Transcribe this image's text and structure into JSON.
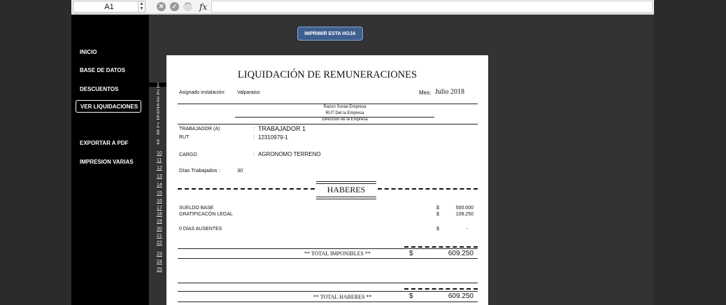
{
  "formula_bar": {
    "cell_ref": "A1",
    "fx_label": "fx"
  },
  "print_button": {
    "label": "IMPRIMIR ESTA HOJA"
  },
  "nav": {
    "inicio": "INICIO",
    "base_datos": "BASE DE DATOS",
    "descuentos": "DESCUENTOS",
    "ver_liquidaciones": "VER LIQUIDACIONES",
    "exportar_pdf": "EXPORTAR A PDF",
    "impresion_varias": "IMPRESION VARIAS"
  },
  "row_numbers": [
    "1",
    "2",
    "3",
    "4",
    "5",
    "6",
    "7",
    "8",
    "9",
    "10",
    "11",
    "12",
    "13",
    "14",
    "15",
    "16",
    "17",
    "18",
    "19",
    "20",
    "21",
    "22",
    "23",
    "24",
    "25"
  ],
  "doc": {
    "title": "LIQUIDACIÓN DE REMUNERACIONES",
    "asignado_label": "Asignado instalación:",
    "asignado_value": "Valparaiso",
    "mes_label": "Mes:",
    "mes_value": "Julio 2018",
    "razon_social": "Razon Social Empresa",
    "rut_empresa": "RUT Del la Empresa",
    "direccion": "Direccion de la Empresa",
    "trabajador_label": "TRABAJADOR (A)",
    "trabajador_value": "TRABAJADOR 1",
    "rut_label": "RUT",
    "rut_value": "12310979-1",
    "cargo_label": "CARGO",
    "cargo_value": "AGRONOMO TERRENO",
    "colon": ":",
    "dias_label": "Días Trabajados :",
    "dias_value": "30",
    "haberes_title": "HABERES",
    "items": [
      {
        "label": "SUELDO BASE",
        "currency": "$",
        "amount": "500.000"
      },
      {
        "label": "GRATIFICACÓN LEGAL",
        "currency": "$",
        "amount": "109.250"
      },
      {
        "label": "0 DÍAS AUSENTES",
        "currency": "$",
        "amount": "-"
      }
    ],
    "total_imponibles_label": "** TOTAL IMPONIBLES **",
    "total_imponibles_currency": "$",
    "total_imponibles_value": "609.250",
    "total_haberes_label": "** TOTAL HABERES **",
    "total_haberes_currency": "$",
    "total_haberes_value": "609.250"
  }
}
